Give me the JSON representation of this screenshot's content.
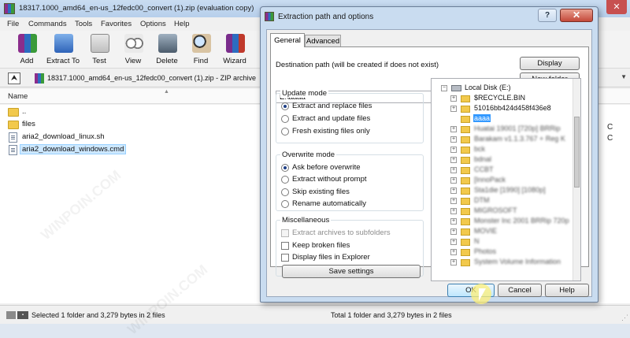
{
  "main": {
    "title": "18317.1000_amd64_en-us_12fedc00_convert (1).zip (evaluation copy)",
    "close_glyph": "✕",
    "menu": [
      "File",
      "Commands",
      "Tools",
      "Favorites",
      "Options",
      "Help"
    ],
    "toolbar": [
      "Add",
      "Extract To",
      "Test",
      "View",
      "Delete",
      "Find",
      "Wizard"
    ],
    "address": "18317.1000_amd64_en-us_12fedc00_convert (1).zip - ZIP archive",
    "column_name": "Name",
    "files": [
      {
        "name": "..",
        "type": "folder"
      },
      {
        "name": "files",
        "type": "folder"
      },
      {
        "name": "aria2_download_linux.sh",
        "type": "file"
      },
      {
        "name": "aria2_download_windows.cmd",
        "type": "file"
      }
    ],
    "side_fragment": [
      "C",
      "C"
    ],
    "status_left": "Selected 1 folder and 3,279 bytes in 2 files",
    "status_right": "Total 1 folder and 3,279 bytes in 2 files",
    "colors": {
      "toolbar_add": "#8b2d8c",
      "toolbar_extract": "#3a7bd5",
      "toolbar_test": "#c0392b",
      "toolbar_view": "#6b7b8c",
      "toolbar_delete": "#5a6b7a",
      "toolbar_find": "#7a5a3a",
      "toolbar_wizard": "#7a2d8c"
    }
  },
  "dialog": {
    "title": "Extraction path and options",
    "help": "?",
    "close": "✕",
    "tabs": [
      "General",
      "Advanced"
    ],
    "dest_label": "Destination path (will be created if does not exist)",
    "dest_value": "E:\\aaaa",
    "display_btn": "Display",
    "new_folder_btn": "New folder",
    "update_mode": {
      "title": "Update mode",
      "options": [
        "Extract and replace files",
        "Extract and update files",
        "Fresh existing files only"
      ],
      "selected": 0
    },
    "overwrite_mode": {
      "title": "Overwrite mode",
      "options": [
        "Ask before overwrite",
        "Extract without prompt",
        "Skip existing files",
        "Rename automatically"
      ],
      "selected": 0
    },
    "misc": {
      "title": "Miscellaneous",
      "options": [
        "Extract archives to subfolders",
        "Keep broken files",
        "Display files in Explorer"
      ]
    },
    "save_btn": "Save settings",
    "tree": [
      "Local Disk (E:)",
      "$RECYCLE.BIN",
      "51016bb424d458f436e8",
      "aaaa",
      "Huatai 19001 [720p] BRRip",
      "Barakam v1.1.3.767 + Reg K",
      "bck",
      "bdnal",
      "CCBT",
      "[InnoPack",
      "Sta1die [1990] [1080p]",
      "DTM",
      "MIGROSOFT",
      "Monster Inc 2001 BRRip 720p",
      "MOVIE",
      "N",
      "Photos",
      "System Volume Information"
    ],
    "ok": "OK",
    "cancel": "Cancel",
    "help_btn": "Help"
  },
  "watermark": "WINPOIN.COM"
}
